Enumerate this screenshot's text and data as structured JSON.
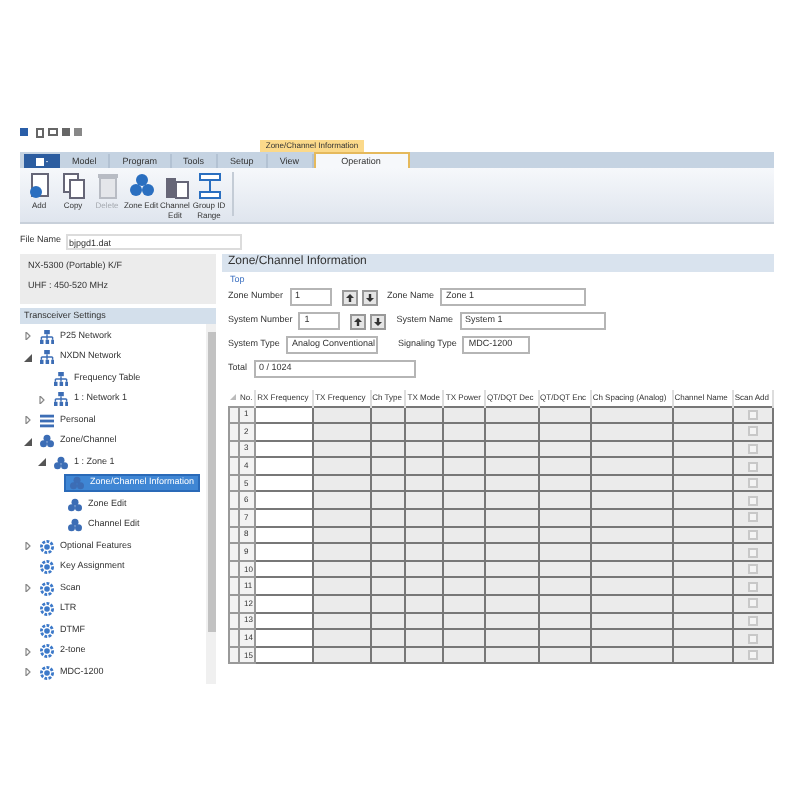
{
  "ribbon": {
    "context_label": "Zone/Channel Information",
    "tabs": [
      {
        "label": "Model",
        "selected": false
      },
      {
        "label": "Program",
        "selected": false
      },
      {
        "label": "Tools",
        "selected": false
      },
      {
        "label": "Setup",
        "selected": false
      },
      {
        "label": "View",
        "selected": false
      },
      {
        "label": "Operation",
        "selected": true
      }
    ],
    "buttons": [
      {
        "label": "Add",
        "kind": "add",
        "disabled": false
      },
      {
        "label": "Copy",
        "kind": "copy",
        "disabled": false
      },
      {
        "label": "Delete",
        "kind": "delete",
        "disabled": true
      },
      {
        "label": "Zone Edit",
        "kind": "zone",
        "disabled": false
      },
      {
        "label": "Channel Edit",
        "kind": "channel",
        "disabled": false
      },
      {
        "label": "Group ID Range",
        "kind": "range",
        "disabled": false
      }
    ]
  },
  "file_name": {
    "label": "File Name",
    "value": "bjpgd1.dat"
  },
  "sidebar": {
    "model": "NX-5300 (Portable) K/F",
    "band": "UHF : 450-520 MHz",
    "header": "Transceiver Settings",
    "items": [
      {
        "label": "P25 Network",
        "kind": "network",
        "expanded": false
      },
      {
        "label": "NXDN Network",
        "kind": "network",
        "expanded": true,
        "children": [
          {
            "label": "Frequency Table",
            "kind": "network"
          },
          {
            "label": "1 : Network 1",
            "kind": "network",
            "expanded": false
          }
        ]
      },
      {
        "label": "Personal",
        "kind": "list",
        "expanded": false
      },
      {
        "label": "Zone/Channel",
        "kind": "group",
        "expanded": true,
        "children": [
          {
            "label": "1 : Zone 1",
            "kind": "group",
            "expanded": true,
            "children": [
              {
                "label": "Zone/Channel Information",
                "kind": "group",
                "selected": true
              },
              {
                "label": "Zone Edit",
                "kind": "group",
                "selected": false
              },
              {
                "label": "Channel Edit",
                "kind": "group",
                "selected": false
              }
            ]
          }
        ]
      },
      {
        "label": "Optional Features",
        "kind": "gear",
        "expanded": false
      },
      {
        "label": "Key Assignment",
        "kind": "gear"
      },
      {
        "label": "Scan",
        "kind": "gear",
        "expanded": false
      },
      {
        "label": "LTR",
        "kind": "gear"
      },
      {
        "label": "DTMF",
        "kind": "gear"
      },
      {
        "label": "2-tone",
        "kind": "gear",
        "expanded": false
      },
      {
        "label": "MDC-1200",
        "kind": "gear",
        "expanded": false
      }
    ]
  },
  "panel": {
    "title": "Zone/Channel Information",
    "top_link": "Top",
    "zone_number": {
      "label": "Zone Number",
      "value": "1"
    },
    "zone_name": {
      "label": "Zone Name",
      "value": "Zone 1"
    },
    "system_number": {
      "label": "System Number",
      "value": "1"
    },
    "system_name": {
      "label": "System Name",
      "value": "System 1"
    },
    "system_type": {
      "label": "System Type",
      "value": "Analog Conventional"
    },
    "signaling_type": {
      "label": "Signaling Type",
      "value": "MDC-1200"
    },
    "total": {
      "label": "Total",
      "value": "0 / 1024"
    }
  },
  "table": {
    "columns": [
      "No.",
      "RX Frequency",
      "TX Frequency",
      "Ch Type",
      "TX Mode",
      "TX Power",
      "QT/DQT Dec",
      "QT/DQT Enc",
      "Ch Spacing (Analog)",
      "Channel Name",
      "Scan Add"
    ],
    "rows": [
      {
        "no": "1",
        "scan_add": false
      },
      {
        "no": "2",
        "scan_add": false
      },
      {
        "no": "3",
        "scan_add": false
      },
      {
        "no": "4",
        "scan_add": false
      },
      {
        "no": "5",
        "scan_add": false
      },
      {
        "no": "6",
        "scan_add": false
      },
      {
        "no": "7",
        "scan_add": false
      },
      {
        "no": "8",
        "scan_add": false
      },
      {
        "no": "9",
        "scan_add": false
      },
      {
        "no": "10",
        "scan_add": false
      },
      {
        "no": "11",
        "scan_add": false
      },
      {
        "no": "12",
        "scan_add": false
      },
      {
        "no": "13",
        "scan_add": false
      },
      {
        "no": "14",
        "scan_add": false
      },
      {
        "no": "15",
        "scan_add": false
      }
    ]
  }
}
